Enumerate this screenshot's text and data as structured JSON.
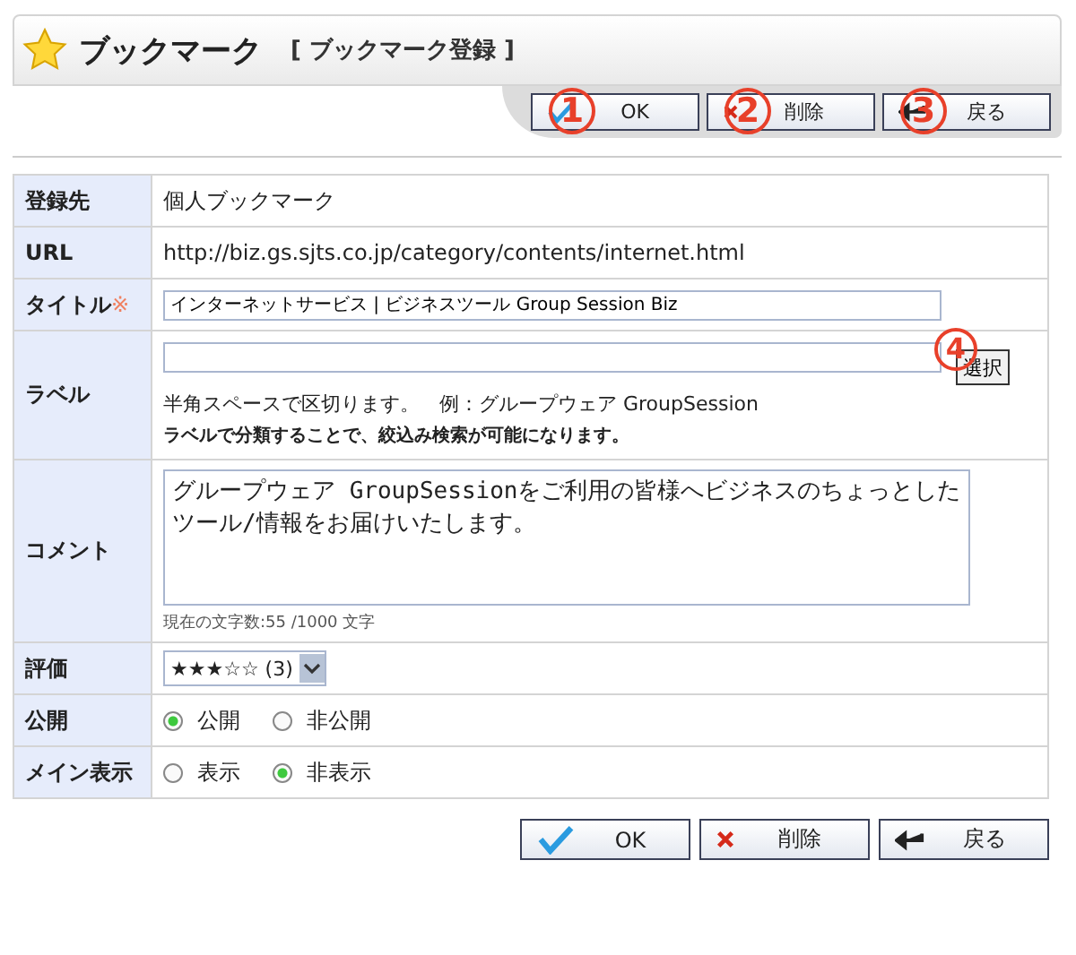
{
  "header": {
    "title": "ブックマーク",
    "subtitle": "[ ブックマーク登録 ]"
  },
  "top_buttons": [
    {
      "kind": "ok",
      "label": "OK",
      "callout": "1"
    },
    {
      "kind": "delete",
      "label": "削除",
      "callout": "2"
    },
    {
      "kind": "back",
      "label": "戻る",
      "callout": "3"
    }
  ],
  "form": {
    "destination": {
      "label": "登録先",
      "value": "個人ブックマーク"
    },
    "url": {
      "label": "URL",
      "value": "http://biz.gs.sjts.co.jp/category/contents/internet.html"
    },
    "title": {
      "label": "タイトル",
      "required_mark": "※",
      "value": "インターネットサービス | ビジネスツール Group Session Biz"
    },
    "label": {
      "label": "ラベル",
      "button": "選択",
      "callout": "4",
      "hint_lines": [
        "半角スペースで区切ります。　例：グループウェア GroupSession",
        "ラベルで分類することで、絞込み検索が可能になります。"
      ]
    },
    "comment": {
      "label": "コメント",
      "value": "グループウェア GroupSessionをご利用の皆様へビジネスのちょっとしたツール/情報をお届けいたします。",
      "counter": "現在の文字数:55 /1000 文字"
    },
    "rating": {
      "label": "評価",
      "value": "★★★☆☆ (3)"
    },
    "public": {
      "label": "公開",
      "options": [
        {
          "label": "公開",
          "selected": true
        },
        {
          "label": "非公開",
          "selected": false
        }
      ]
    },
    "main_display": {
      "label": "メイン表示",
      "options": [
        {
          "label": "表示",
          "selected": false
        },
        {
          "label": "非表示",
          "selected": true
        }
      ]
    }
  },
  "bottom_buttons": [
    {
      "kind": "ok",
      "label": "OK"
    },
    {
      "kind": "delete",
      "label": "削除"
    },
    {
      "kind": "back",
      "label": "戻る"
    }
  ]
}
